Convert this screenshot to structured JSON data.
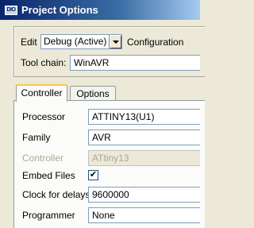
{
  "window": {
    "title": "Project Options",
    "icon_text": "DIO"
  },
  "top": {
    "edit_label": "Edit",
    "edit_value": "Debug (Active)",
    "configuration_label": "Configuration",
    "toolchain_label": "Tool chain:",
    "toolchain_value": "WinAVR"
  },
  "tabs": [
    {
      "label": "Controller",
      "active": true
    },
    {
      "label": "Options",
      "active": false
    }
  ],
  "controller": {
    "processor_label": "Processor",
    "processor_value": "ATTINY13(U1)",
    "family_label": "Family",
    "family_value": "AVR",
    "controller_label": "Controller",
    "controller_value": "ATtiny13",
    "embed_files_label": "Embed Files",
    "embed_files_checked": true,
    "embed_files_mark": "✔",
    "clock_label": "Clock for delays",
    "clock_value": "9600000",
    "programmer_label": "Programmer",
    "programmer_value": "None"
  }
}
